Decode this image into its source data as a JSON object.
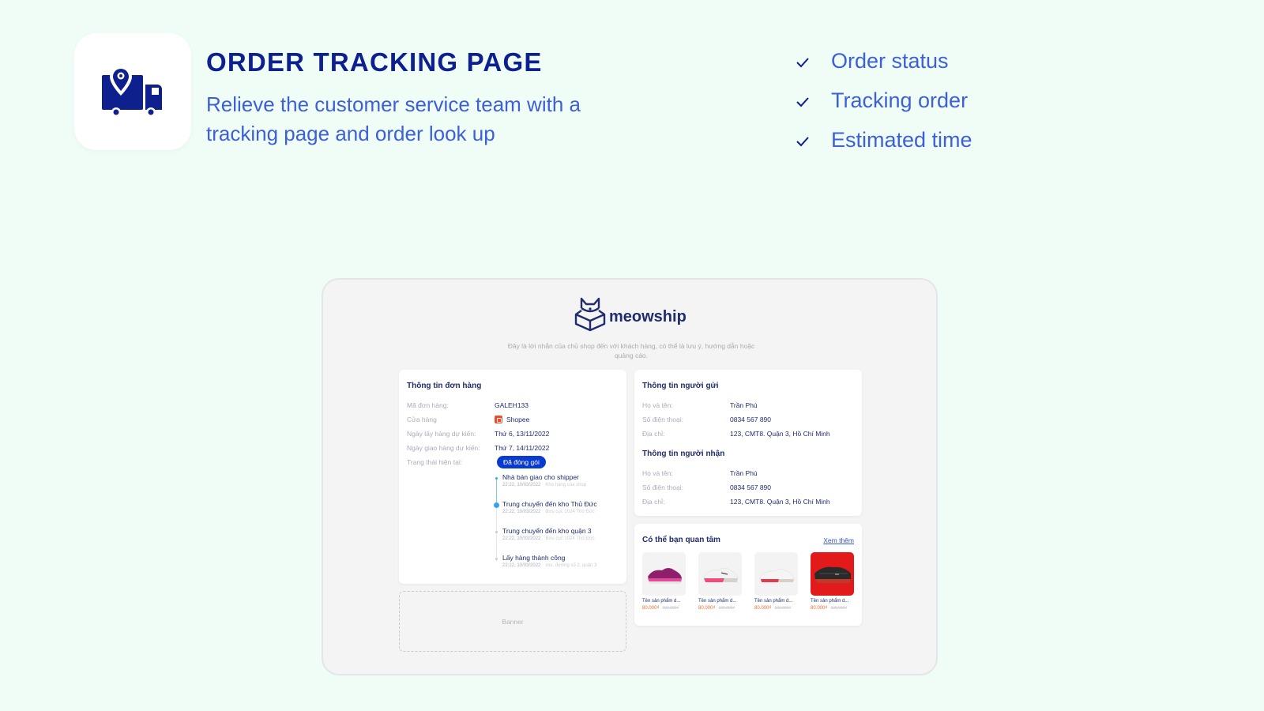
{
  "hero": {
    "icon": "delivery-truck-location-icon",
    "title": "ORDER TRACKING PAGE",
    "subtitle": "Relieve the customer service team with a tracking page and order look up",
    "brand_color": "#0e1f8e",
    "accent_color": "#3d5fd8"
  },
  "features": [
    {
      "icon": "check-icon",
      "label": "Order status"
    },
    {
      "icon": "check-icon",
      "label": "Tracking order"
    },
    {
      "icon": "check-icon",
      "label": "Estimated time"
    }
  ],
  "mockup": {
    "brand": {
      "logo": "cat-box-logo",
      "name": "meowship"
    },
    "shop_message": "Đây là lời nhắn của chủ shop đến với khách hàng, có thể là lưu ý, hướng dẫn hoặc quảng cáo.",
    "order_info": {
      "title": "Thông tin đơn hàng",
      "rows": [
        {
          "label": "Mã đơn hàng:",
          "value": "GALEH133"
        },
        {
          "label": "Cửa hàng",
          "value": "Shopee",
          "icon": "shopee-icon"
        },
        {
          "label": "Ngày lấy hàng dự kiến:",
          "value": "Thứ 6, 13/11/2022"
        },
        {
          "label": "Ngày giao hàng dự kiến:",
          "value": "Thứ 7, 14/11/2022"
        },
        {
          "label": "Trạng thái hiện tại:",
          "value": ""
        }
      ],
      "status_badge": "Đã đóng gói",
      "status_color": "#0a3bd1",
      "timeline": [
        {
          "title": "Nhà bán giao cho shipper",
          "time": "22:22, 10/03/2022",
          "location": "Kho hàng của shop"
        },
        {
          "title": "Trung chuyển đến kho Thủ Đức",
          "time": "22:22, 10/03/2022",
          "location": "Bưu cục 1024 Thủ Đức",
          "active": true
        },
        {
          "title": "Trung chuyển đến kho quận 3",
          "time": "22:22, 10/03/2022",
          "location": "Bưu cục 1024 Thủ Đức"
        },
        {
          "title": "Lấy hàng thành công",
          "time": "22:22, 10/03/2022",
          "location": "xxx, đường số 2, quận 3"
        }
      ]
    },
    "banner_label": "Banner",
    "sender": {
      "title": "Thông tin người gửi",
      "rows": [
        {
          "label": "Họ và tên:",
          "value": "Trần Phú"
        },
        {
          "label": "Số điện thoại:",
          "value": "0834 567 890"
        },
        {
          "label": "Địa chỉ:",
          "value": "123, CMT8. Quận 3, Hồ Chí Minh"
        }
      ]
    },
    "receiver": {
      "title": "Thông tin người nhận",
      "rows": [
        {
          "label": "Họ và tên:",
          "value": "Trần Phú"
        },
        {
          "label": "Số điện thoại:",
          "value": "0834 567 890"
        },
        {
          "label": "Địa chỉ:",
          "value": "123, CMT8. Quận 3, Hồ Chí Minh"
        }
      ]
    },
    "suggestions": {
      "title": "Có thể bạn quan tâm",
      "see_more": "Xem thêm",
      "products": [
        {
          "name": "Tên sản phẩm d...",
          "price": "80.000₫",
          "old_price": "100.000₫",
          "image": "pink-purple-running-shoe"
        },
        {
          "name": "Tên sản phẩm d...",
          "price": "80.000₫",
          "old_price": "100.000₫",
          "image": "white-pink-running-shoe"
        },
        {
          "name": "Tên sản phẩm d...",
          "price": "80.000₫",
          "old_price": "100.000₫",
          "image": "white-red-running-shoe"
        },
        {
          "name": "Tên sản phẩm d...",
          "price": "80.000₫",
          "old_price": "100.000₫",
          "image": "black-red-air-max-shoe"
        }
      ]
    }
  }
}
